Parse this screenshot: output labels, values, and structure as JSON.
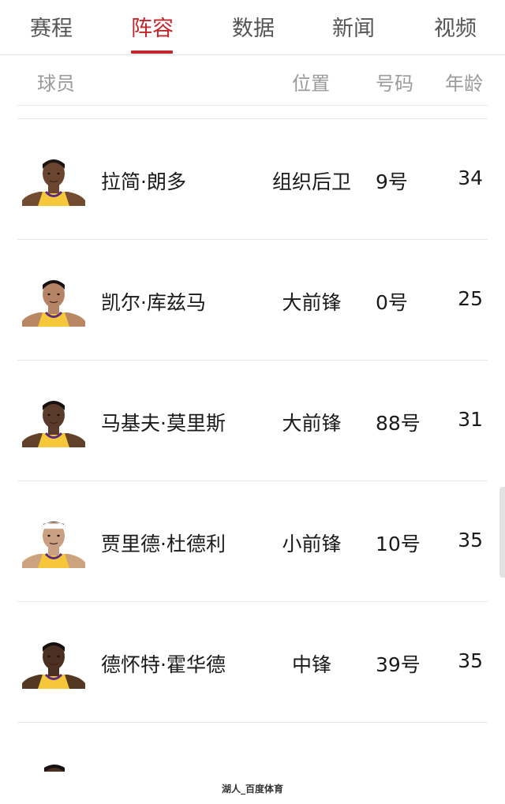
{
  "tabs": [
    {
      "label": "赛程",
      "active": false
    },
    {
      "label": "阵容",
      "active": true
    },
    {
      "label": "数据",
      "active": false
    },
    {
      "label": "新闻",
      "active": false
    },
    {
      "label": "视频",
      "active": false
    }
  ],
  "columns": {
    "player": "球员",
    "position": "位置",
    "number": "号码",
    "age": "年龄"
  },
  "players": [
    {
      "name": "拉简·朗多",
      "position": "组织后卫",
      "number": "9号",
      "age": "34",
      "skin": "#6b4530",
      "hair": "#1c1411"
    },
    {
      "name": "凯尔·库兹马",
      "position": "大前锋",
      "number": "0号",
      "age": "25",
      "skin": "#b58466",
      "hair": "#171211"
    },
    {
      "name": "马基夫·莫里斯",
      "position": "大前锋",
      "number": "88号",
      "age": "31",
      "skin": "#5a3a2a",
      "hair": "#161010"
    },
    {
      "name": "贾里德·杜德利",
      "position": "小前锋",
      "number": "10号",
      "age": "35",
      "skin": "#caa082",
      "hair": "#ffffff"
    },
    {
      "name": "德怀特·霍华德",
      "position": "中锋",
      "number": "39号",
      "age": "35",
      "skin": "#4c3022",
      "hair": "#161010"
    }
  ],
  "colors": {
    "accent": "#c3272b",
    "jersey": "#f6c73b",
    "jersey_trim": "#5a2d82"
  },
  "watermark": "湖人_百度体育"
}
